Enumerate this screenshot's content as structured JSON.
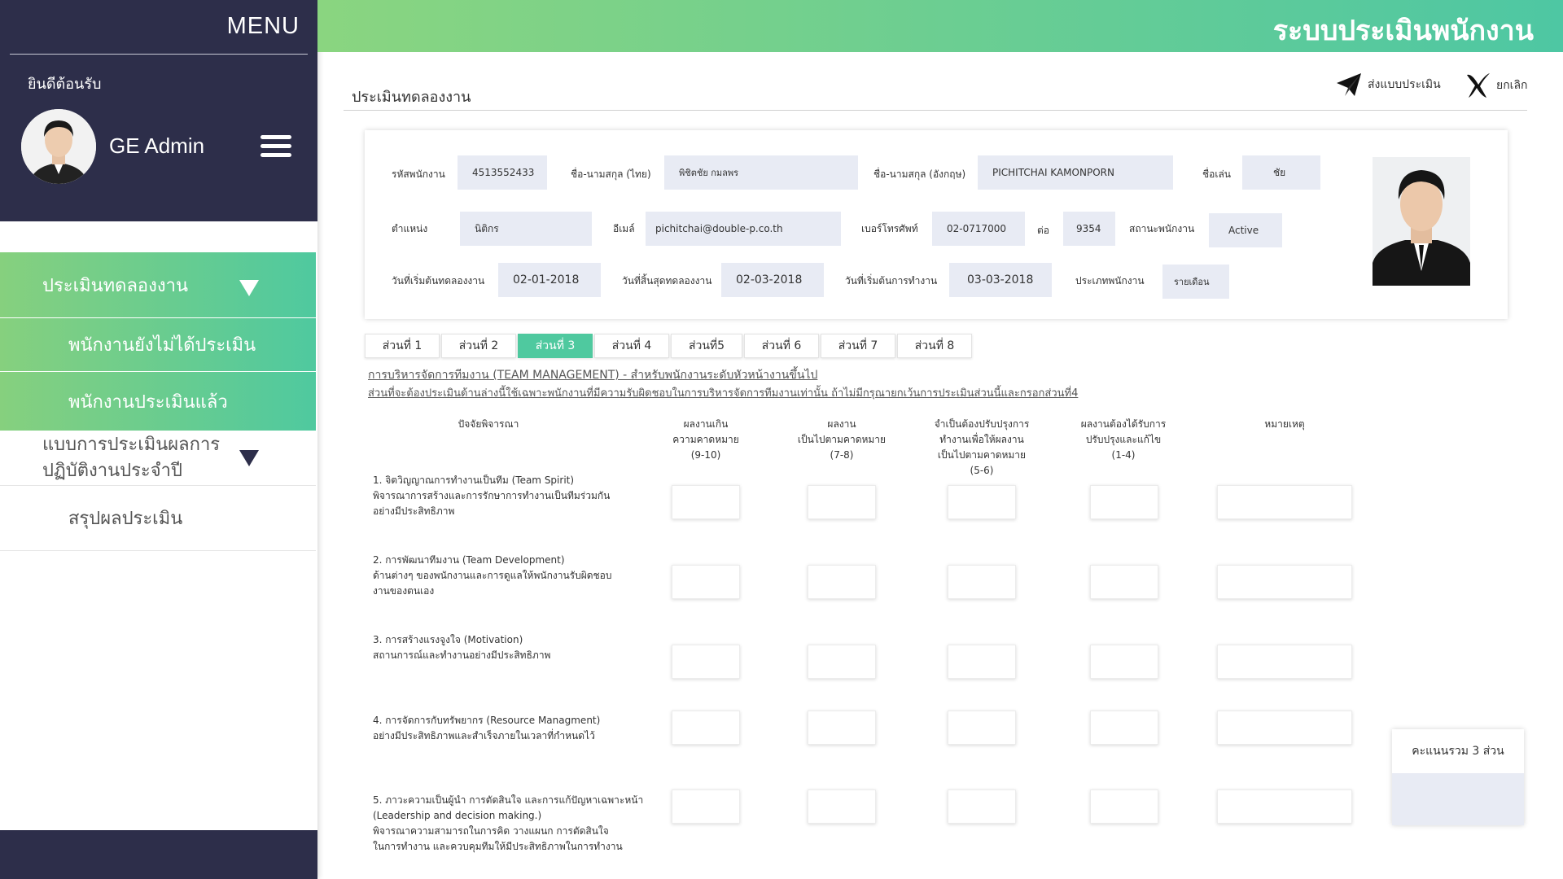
{
  "sidebar": {
    "menu_title": "MENU",
    "welcome": "ยินดีต้อนรับ",
    "username": "GE Admin",
    "items": [
      {
        "label": "ประเมินทดลองงาน"
      },
      {
        "label": "พนักงานยังไม่ได้ประเมิน"
      },
      {
        "label": "พนักงานประเมินแล้ว"
      },
      {
        "label": "แบบการประเมินผลการ"
      },
      {
        "label": "สรุปผลประเมิน"
      }
    ],
    "item4_line2": "ปฏิบัติงานประจำปี"
  },
  "header": {
    "title": "ระบบประเมินพนักงาน"
  },
  "page": {
    "title": "ประเมินทดลองงาน",
    "send_label": "ส่งแบบประเมิน",
    "cancel_label": "ยกเลิก"
  },
  "employee": {
    "labels": {
      "emp_id": "รหัสพนักงาน",
      "name_th": "ชื่อ-นามสกุล (ไทย)",
      "name_en": "ชื่อ-นามสกุล (อังกฤษ)",
      "nickname": "ชื่อเล่น",
      "position": "ตำแหน่ง",
      "email": "อีเมล์",
      "phone": "เบอร์โทรศัพท์",
      "ext": "ต่อ",
      "status": "สถานะพนักงาน",
      "probation_start": "วันที่เริ่มต้นทดลองงาน",
      "probation_end": "วันที่สิ้นสุดทดลองงาน",
      "work_start": "วันที่เริ่มต้นการทำงาน",
      "emp_type": "ประเภทพนักงาน"
    },
    "values": {
      "emp_id": "4513552433",
      "name_th": "พิชิตชัย     กมลพร",
      "name_en": "PICHITCHAI      KAMONPORN",
      "nickname": "ชัย",
      "position": "นิติกร",
      "email": "pichitchai@double-p.co.th",
      "phone": "02-0717000",
      "ext": "9354",
      "status": "Active",
      "probation_start": "02-01-2018",
      "probation_end": "02-03-2018",
      "work_start": "03-03-2018",
      "emp_type": "รายเดือน"
    }
  },
  "tabs": [
    {
      "label": "ส่วนที่ 1"
    },
    {
      "label": "ส่วนที่ 2"
    },
    {
      "label": "ส่วนที่ 3"
    },
    {
      "label": "ส่วนที่ 4"
    },
    {
      "label": "ส่วนที่5"
    },
    {
      "label": "ส่วนที่ 6"
    },
    {
      "label": "ส่วนที่ 7"
    },
    {
      "label": "ส่วนที่ 8"
    }
  ],
  "section": {
    "heading": "การบริหารจัดการทีมงาน (TEAM MANAGEMENT) - สำหรับพนักงานระดับหัวหน้างานขึ้นไป",
    "note": "ส่วนที่จะต้องประเมินด้านล่างนี้ใช้เฉพาะพนักงานที่มีความรับผิดชอบในการบริหารจัดการทีมงานเท่านั้น ถ้าไม่มีกรุณายกเว้นการประเมินส่วนนี้และกรอกส่วนที่4"
  },
  "columns": {
    "factor": "ปัจจัยพิจารณา",
    "c1": [
      "ผลงานเกิน",
      "ความคาดหมาย",
      "(9-10)"
    ],
    "c2": [
      "ผลงาน",
      "เป็นไปตามคาดหมาย",
      "(7-8)"
    ],
    "c3": [
      "จำเป็นต้องปรับปรุงการ",
      "ทำงานเพื่อให้ผลงาน",
      "เป็นไปตามคาดหมาย",
      "(5-6)"
    ],
    "c4": [
      "ผลงานต้องได้รับการ",
      "ปรับปรุงและแก้ไข",
      "(1-4)"
    ],
    "remark": "หมายเหตุ"
  },
  "criteria": [
    {
      "lines": [
        "1. จิตวิญญาณการทำงานเป็นทีม (Team Spirit)",
        "    พิจารณาการสร้างและการรักษาการทำงานเป็นทีมร่วมกัน",
        "    อย่างมีประสิทธิภาพ"
      ]
    },
    {
      "lines": [
        "2. การพัฒนาทีมงาน (Team Development)",
        "    ด้านต่างๆ ของพนักงานและการดูแลให้พนักงานรับผิดชอบ",
        "    งานของตนเอง"
      ]
    },
    {
      "lines": [
        "3. การสร้างแรงจูงใจ (Motivation)",
        "    สถานการณ์และทำงานอย่างมีประสิทธิภาพ"
      ]
    },
    {
      "lines": [
        "4. การจัดการกับทรัพยากร (Resource Managment)",
        "    อย่างมีประสิทธิภาพและสำเร็จภายในเวลาที่กำหนดไว้"
      ]
    },
    {
      "lines": [
        "5. ภาวะความเป็นผู้นำ การตัดสินใจ และการแก้ปัญหาเฉพาะหน้า",
        "    (Leadership and decision making.)",
        "    พิจารณาความสามารถในการคิด วางแผนก การตัดสินใจ",
        "    ในการทำงาน และควบคุมทีมให้มีประสิทธิภาพในการทำงาน"
      ]
    }
  ],
  "score": {
    "label": "คะแนนรวม 3 ส่วน"
  },
  "colors": {
    "sidebar": "#2d2e4a",
    "accent_green": "#4fc99f",
    "field_bg": "#e8ebf4"
  }
}
